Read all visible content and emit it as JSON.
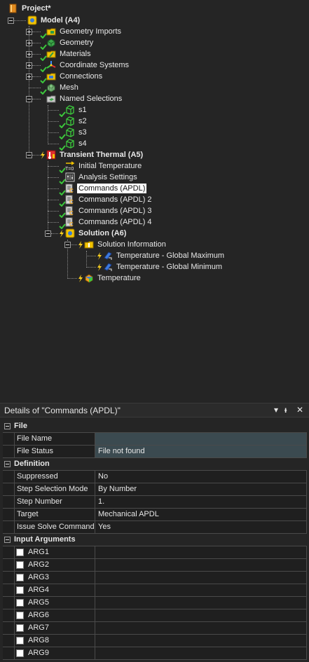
{
  "tree": {
    "project": "Project*",
    "model": "Model (A4)",
    "geometry_imports": "Geometry Imports",
    "geometry": "Geometry",
    "materials": "Materials",
    "coordinate_systems": "Coordinate Systems",
    "connections": "Connections",
    "mesh": "Mesh",
    "named_selections": "Named Selections",
    "ns": [
      "s1",
      "s2",
      "s3",
      "s4"
    ],
    "transient_thermal": "Transient Thermal (A5)",
    "initial_temperature": "Initial Temperature",
    "analysis_settings": "Analysis Settings",
    "commands": [
      "Commands (APDL)",
      "Commands (APDL) 2",
      "Commands (APDL) 3",
      "Commands (APDL) 4"
    ],
    "solution": "Solution (A6)",
    "solution_information": "Solution Information",
    "temp_global_max": "Temperature - Global Maximum",
    "temp_global_min": "Temperature - Global Minimum",
    "temperature": "Temperature"
  },
  "details": {
    "title": "Details of \"Commands (APDL)\"",
    "controls": {
      "dropdown": "▾",
      "pin": "ᵻ",
      "close": "✕"
    },
    "groups": {
      "file": "File",
      "definition": "Definition",
      "input_arguments": "Input Arguments"
    },
    "file_name": {
      "key": "File Name",
      "value": ""
    },
    "file_status": {
      "key": "File Status",
      "value": "File not found"
    },
    "suppressed": {
      "key": "Suppressed",
      "value": "No"
    },
    "step_selection_mode": {
      "key": "Step Selection Mode",
      "value": "By Number"
    },
    "step_number": {
      "key": "Step Number",
      "value": "1."
    },
    "target": {
      "key": "Target",
      "value": "Mechanical APDL"
    },
    "issue_solve": {
      "key": "Issue Solve Command",
      "value": "Yes"
    },
    "args": [
      "ARG1",
      "ARG2",
      "ARG3",
      "ARG4",
      "ARG5",
      "ARG6",
      "ARG7",
      "ARG8",
      "ARG9"
    ]
  },
  "colors": {
    "check": "#3cc83c",
    "bolt": "#ffd21e",
    "selection_bg": "#ffffff",
    "value_teal": "#3b4a50"
  }
}
